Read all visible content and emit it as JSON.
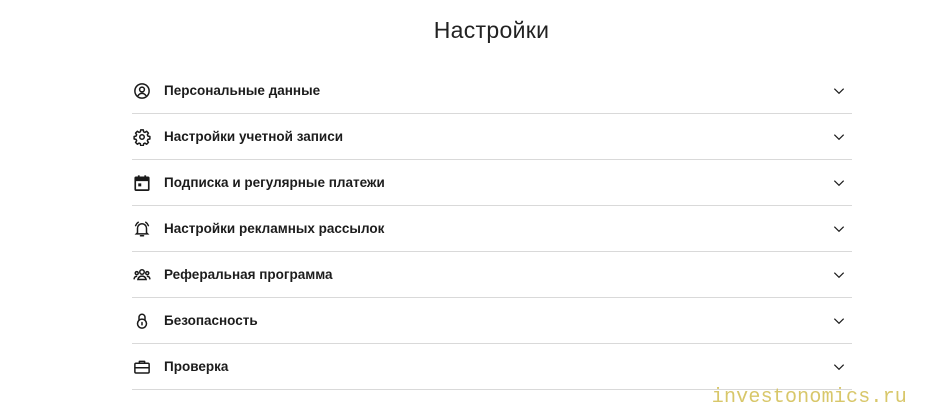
{
  "page": {
    "title": "Настройки"
  },
  "settings": {
    "items": [
      {
        "label": "Персональные данные",
        "icon": "user-circle-icon"
      },
      {
        "label": "Настройки учетной записи",
        "icon": "gear-icon"
      },
      {
        "label": "Подписка и регулярные платежи",
        "icon": "calendar-icon"
      },
      {
        "label": "Настройки рекламных рассылок",
        "icon": "bell-ringing-icon"
      },
      {
        "label": "Реферальная программа",
        "icon": "people-group-icon"
      },
      {
        "label": "Безопасность",
        "icon": "lock-icon"
      },
      {
        "label": "Проверка",
        "icon": "briefcase-icon"
      }
    ],
    "chevron_icon": "chevron-down-icon"
  },
  "watermark": {
    "text": "investonomics.ru"
  },
  "colors": {
    "text": "#1c1c1c",
    "divider": "#d9d9d9",
    "watermark": "#d8c76a"
  }
}
